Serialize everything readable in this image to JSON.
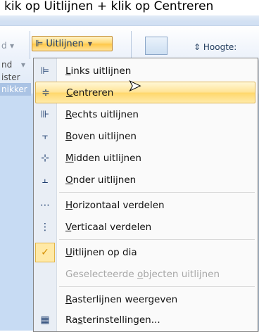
{
  "caption": "kik op Uitlijnen + klik op Centreren",
  "ribbon": {
    "fragments": [
      "d",
      "nd",
      "ister",
      "nikker"
    ],
    "align_button_label": "Uitlijnen",
    "height_label": "Hoogte:"
  },
  "menu": {
    "items": [
      {
        "label_pre": "",
        "label_u": "L",
        "label_post": "inks uitlijnen",
        "icon": "align-left-icon",
        "glyph": "⊫"
      },
      {
        "label_pre": "",
        "label_u": "C",
        "label_post": "entreren",
        "icon": "align-center-icon",
        "glyph": "≑",
        "state": "hover"
      },
      {
        "label_pre": "",
        "label_u": "R",
        "label_post": "echts uitlijnen",
        "icon": "align-right-icon",
        "glyph": "⊪"
      },
      {
        "label_pre": "",
        "label_u": "B",
        "label_post": "oven uitlijnen",
        "icon": "align-top-icon",
        "glyph": "⫟"
      },
      {
        "label_pre": "",
        "label_u": "M",
        "label_post": "idden uitlijnen",
        "icon": "align-middle-icon",
        "glyph": "⊹"
      },
      {
        "label_pre": "",
        "label_u": "O",
        "label_post": "nder uitlijnen",
        "icon": "align-bottom-icon",
        "glyph": "⫠"
      },
      {
        "label_pre": "",
        "label_u": "H",
        "label_post": "orizontaal verdelen",
        "icon": "distribute-horizontal-icon",
        "glyph": "⋯"
      },
      {
        "label_pre": "",
        "label_u": "V",
        "label_post": "erticaal verdelen",
        "icon": "distribute-vertical-icon",
        "glyph": "⋮"
      },
      {
        "label_pre": "",
        "label_u": "U",
        "label_post": "itlijnen op dia",
        "icon": "checkmark-icon",
        "glyph": "✓",
        "state": "checked"
      },
      {
        "label_pre": "Geselecteerde ",
        "label_u": "o",
        "label_post": "bjecten uitlijnen",
        "icon": "",
        "glyph": "",
        "state": "disabled"
      },
      {
        "label_pre": "",
        "label_u": "R",
        "label_post": "asterlijnen weergeven",
        "icon": "",
        "glyph": ""
      },
      {
        "label_pre": "Ra",
        "label_u": "s",
        "label_post": "terinstellingen...",
        "icon": "grid-icon",
        "glyph": "▦"
      }
    ]
  }
}
